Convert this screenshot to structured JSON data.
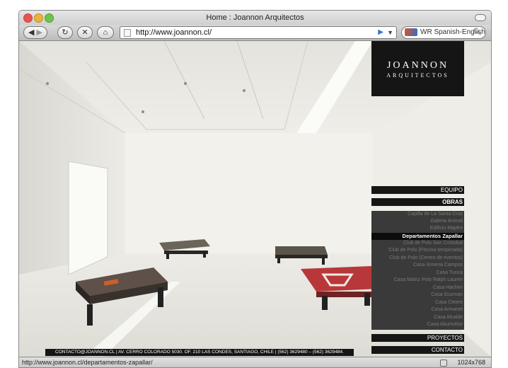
{
  "window": {
    "title": "Home : Joannon Arquitectos"
  },
  "toolbar": {
    "back_icon": "back-arrow",
    "forward_icon": "forward-arrow",
    "reload_icon": "reload",
    "stop_icon": "stop",
    "home_icon": "home",
    "url": "http://www.joannon.cl/",
    "search_placeholder": "WR Spanish-English"
  },
  "logo": {
    "line1": "JOANNON",
    "line2": "ARQUITECTOS"
  },
  "menu": {
    "equipo": "EQUIPO",
    "obras": "OBRAS",
    "proyectos": "PROYECTOS",
    "contacto": "CONTACTO"
  },
  "submenu": {
    "items": [
      "Capilla de La Santa Cruz",
      "Galeria Animal",
      "Edificio Mapfre",
      "Departamentos Zapallar",
      "Club de Polo San Cristobal",
      "Club de Polo (Piscina temperada)",
      "Club de Polo (Centro de eventos)",
      "Casa Ximena Campos",
      "Casa Tunca",
      "Casa Matriz Polo Ralph Lauren",
      "Casa Hachim",
      "Casa Guzman",
      "Casa Cleere",
      "Casa Armanet",
      "Casa Alcalde",
      "Casa Abumohor"
    ],
    "active_index": 3
  },
  "footer": {
    "text": "CONTACTO@JOANNON.CL | AV. CERRO COLORADO 5030. OF. 210 LAS CONDES, SANTIAGO, CHILE | (562) 3629480 – (562) 3629484."
  },
  "status": {
    "url": "http://www.joannon.cl/departamentos-zapallar/",
    "resolution": "1024x768"
  }
}
